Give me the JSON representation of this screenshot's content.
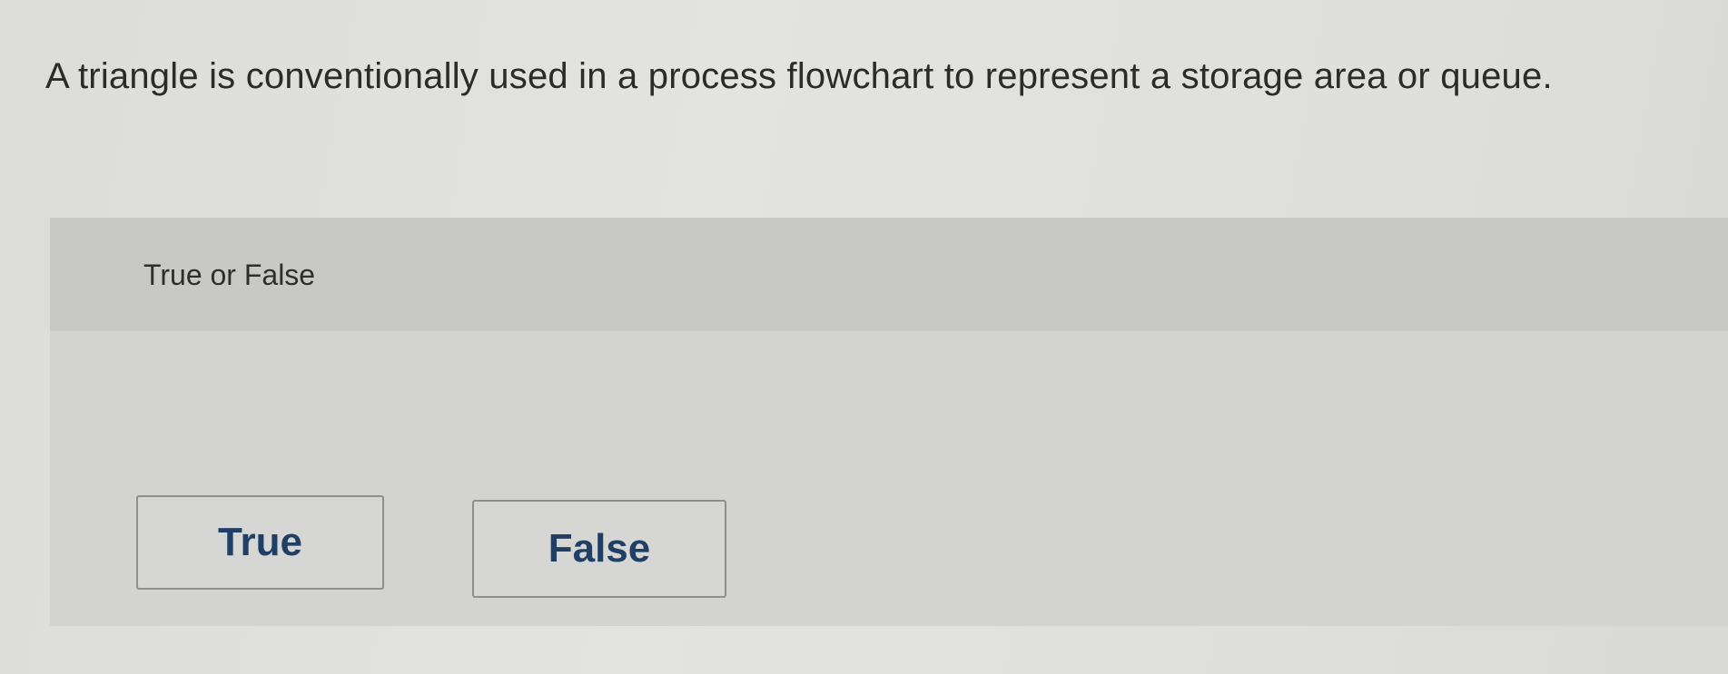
{
  "question": {
    "text": "A triangle is conventionally used in a process flowchart to represent a storage area or queue."
  },
  "answer_panel": {
    "instruction": "True or False",
    "options": [
      {
        "label": "True"
      },
      {
        "label": "False"
      }
    ]
  },
  "colors": {
    "question_text": "#2b2b2b",
    "option_text": "#1f3f66",
    "option_border": "#8e8e8c",
    "panel_background": "#cfcfcd"
  }
}
